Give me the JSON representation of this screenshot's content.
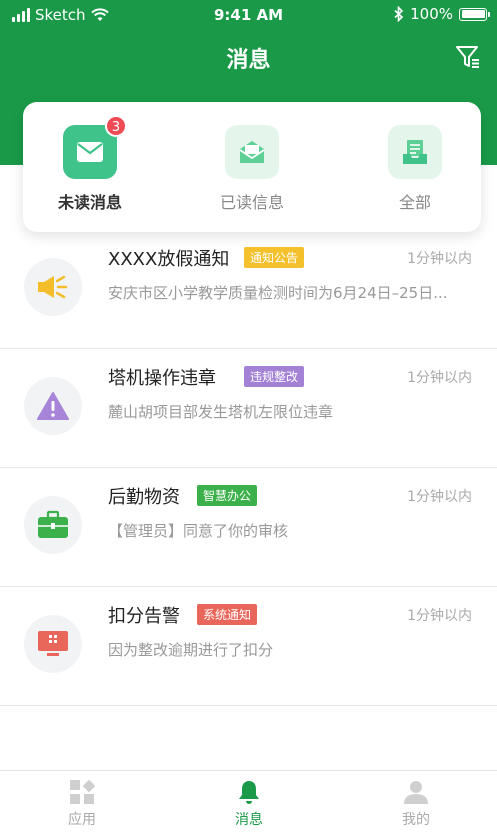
{
  "status": {
    "carrier": "Sketch",
    "time": "9:41 AM",
    "battery": "100%"
  },
  "header": {
    "title": "消息"
  },
  "tabs": [
    {
      "label": "未读消息",
      "badge": "3",
      "active": true
    },
    {
      "label": "已读信息",
      "active": false
    },
    {
      "label": "全部",
      "active": false
    }
  ],
  "messages": [
    {
      "title": "XXXX放假通知",
      "tag": "通知公告",
      "tag_color": "#f4c12c",
      "time": "1分钟以内",
      "desc": "安庆市区小学教学质量检测时间为6月24日–25日...",
      "icon": "megaphone-icon"
    },
    {
      "title": "塔机操作违章",
      "tag": "违规整改",
      "tag_color": "#a382d6",
      "time": "1分钟以内",
      "desc": "麓山胡项目部发生塔机左限位违章",
      "icon": "warning-icon"
    },
    {
      "title": "后勤物资",
      "tag": "智慧办公",
      "tag_color": "#3cb04a",
      "time": "1分钟以内",
      "desc": "【管理员】同意了你的审核",
      "icon": "briefcase-icon"
    },
    {
      "title": "扣分告警",
      "tag": "系统通知",
      "tag_color": "#e9665a",
      "time": "1分钟以内",
      "desc": "因为整改逾期进行了扣分",
      "icon": "monitor-icon"
    }
  ],
  "tabbar": [
    {
      "label": "应用",
      "active": false
    },
    {
      "label": "消息",
      "active": true
    },
    {
      "label": "我的",
      "active": false
    }
  ],
  "colors": {
    "primary": "#1a9a48",
    "badge": "#ee4b55"
  }
}
